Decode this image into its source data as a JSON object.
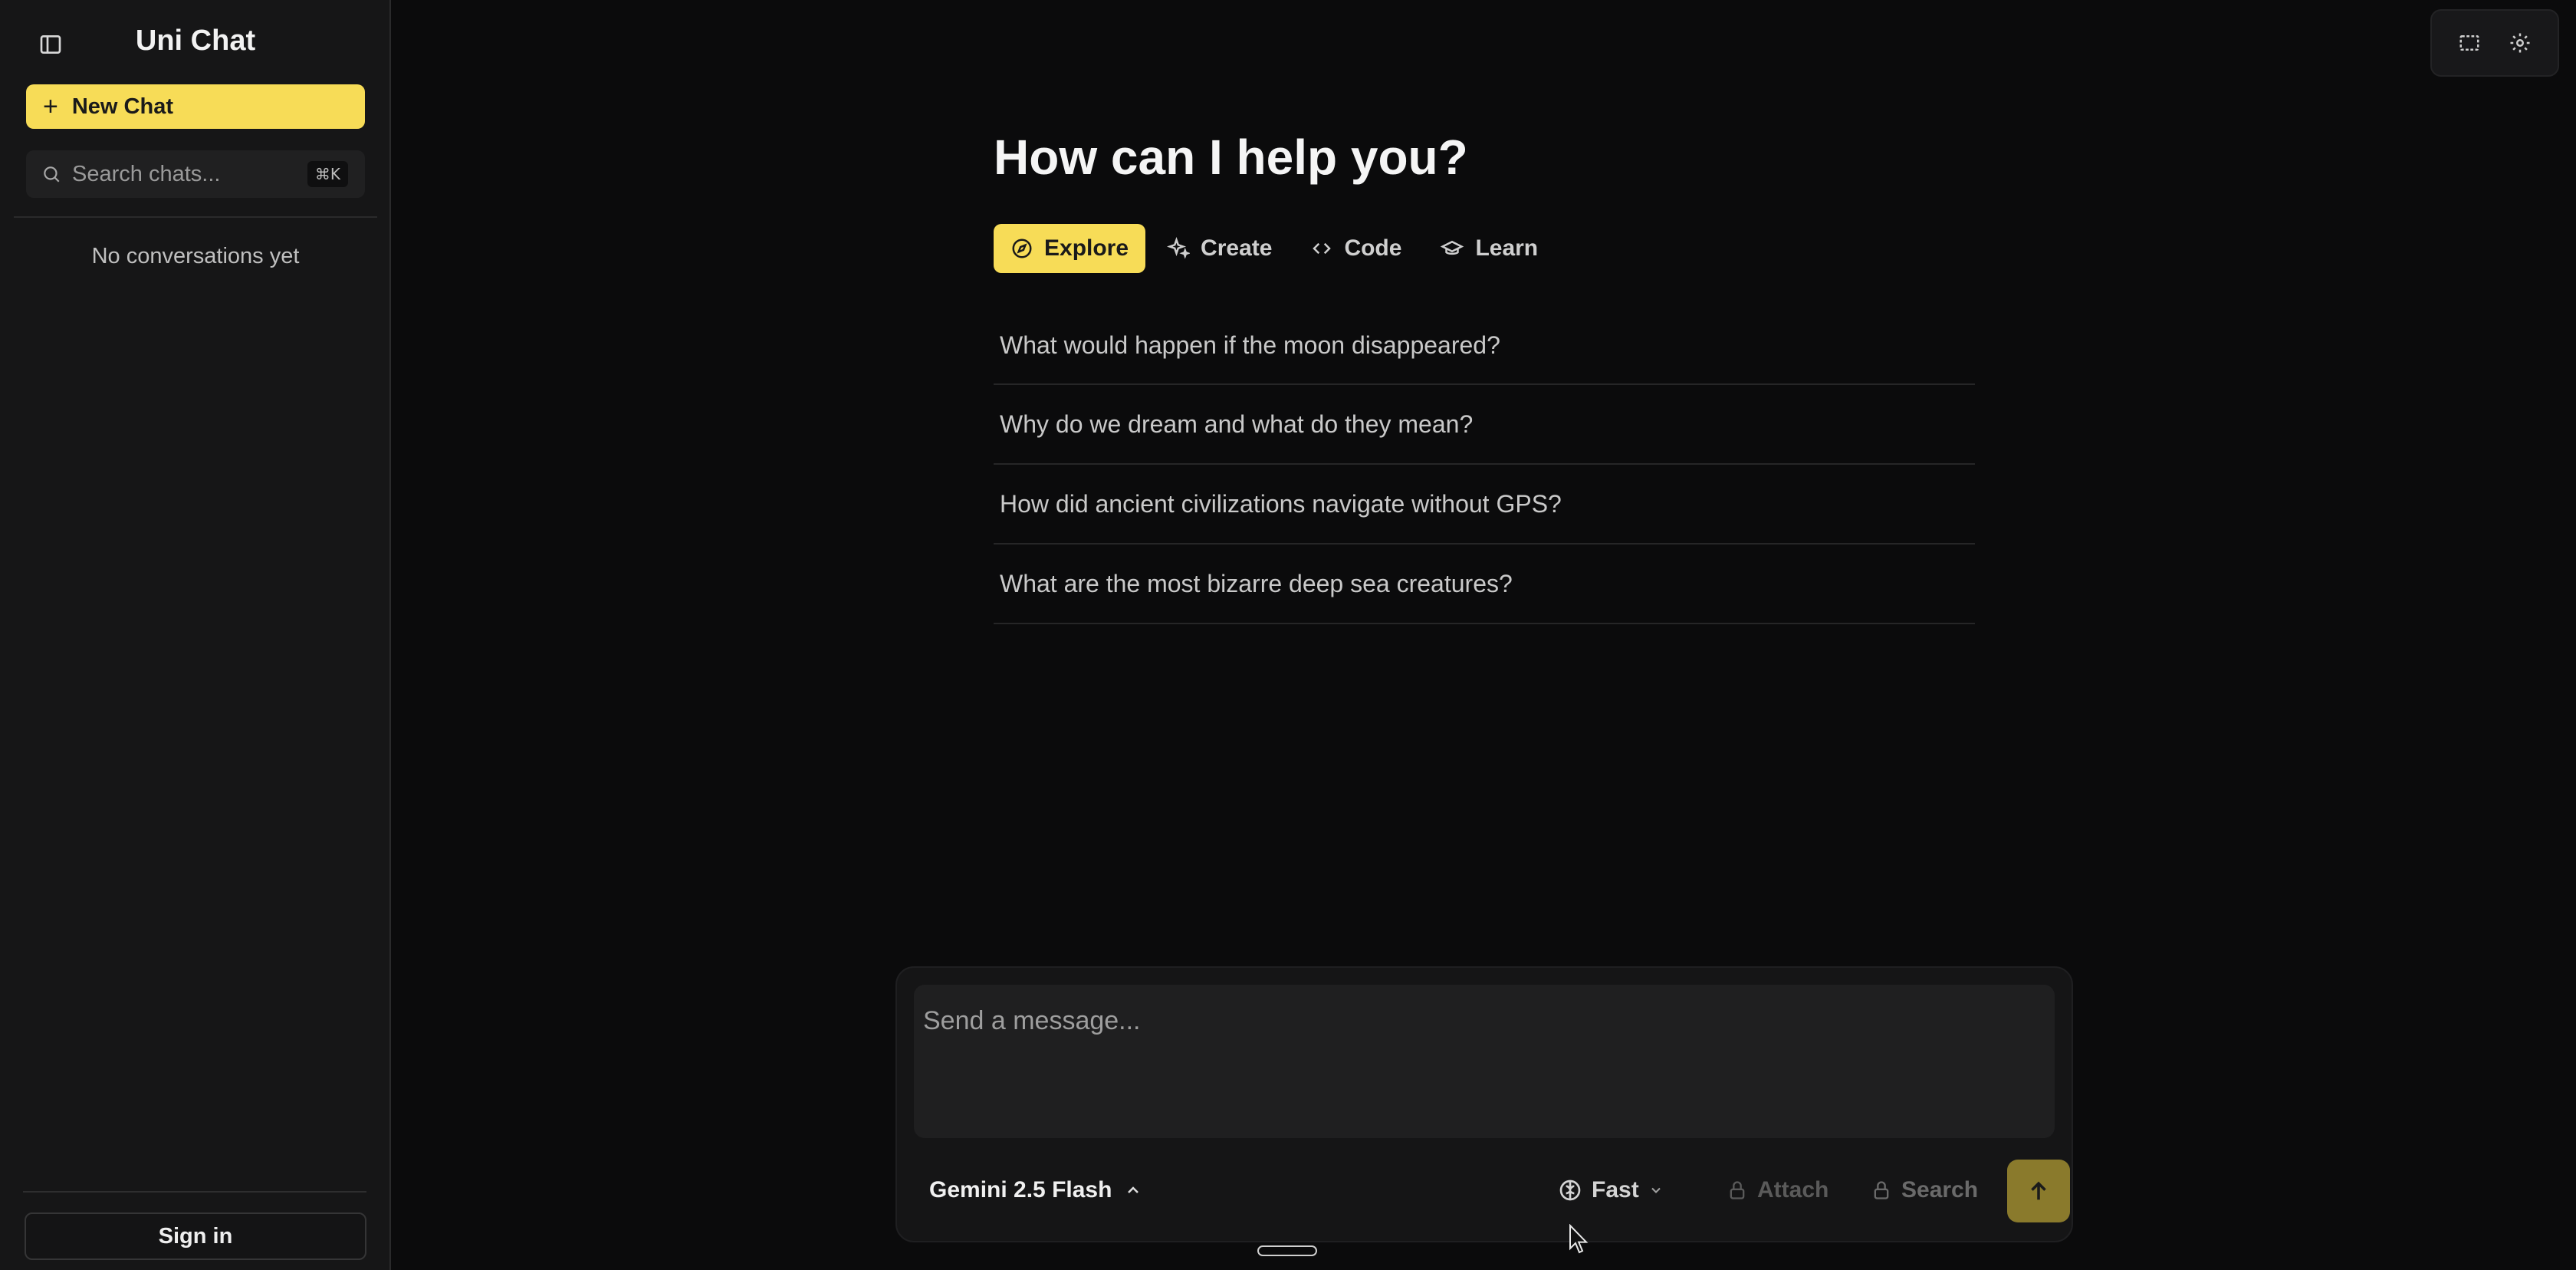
{
  "sidebar": {
    "title": "Uni Chat",
    "new_chat_label": "New Chat",
    "search_placeholder": "Search chats...",
    "search_shortcut": "⌘K",
    "empty_text": "No conversations yet",
    "sign_in_label": "Sign in"
  },
  "main": {
    "heading": "How can I help you?",
    "tabs": [
      {
        "label": "Explore",
        "icon": "compass-icon",
        "active": true
      },
      {
        "label": "Create",
        "icon": "sparkles-icon",
        "active": false
      },
      {
        "label": "Code",
        "icon": "code-icon",
        "active": false
      },
      {
        "label": "Learn",
        "icon": "graduation-cap-icon",
        "active": false
      }
    ],
    "suggestions": [
      "What would happen if the moon disappeared?",
      "Why do we dream and what do they mean?",
      "How did ancient civilizations navigate without GPS?",
      "What are the most bizarre deep sea creatures?"
    ]
  },
  "composer": {
    "placeholder": "Send a message...",
    "model_label": "Gemini 2.5 Flash",
    "mode_label": "Fast",
    "attach_label": "Attach",
    "search_label": "Search"
  },
  "colors": {
    "accent": "#f7dc57",
    "background": "#0b0b0c",
    "sidebar": "#161617",
    "send_button": "#8a7a2c"
  }
}
